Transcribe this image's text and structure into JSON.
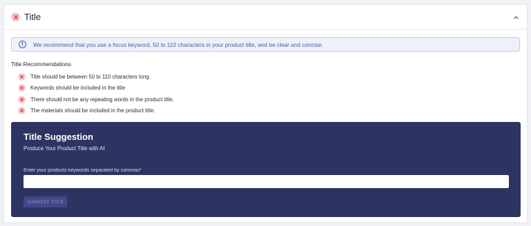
{
  "section": {
    "title": "Title",
    "status": "error",
    "expanded": true
  },
  "info": {
    "icon": "info-circle-icon",
    "text": "We recommend that you use a focus keyword, 50 to 110 characters in your product title, and be clear and concise."
  },
  "recommendations": {
    "heading": "Title Recommendations",
    "items": [
      {
        "label": "Title should be between 50 to 110 characters long",
        "status": "error"
      },
      {
        "label": "Keywords should be included in the title",
        "status": "error"
      },
      {
        "label": "There should not be any repeating words in the product title.",
        "status": "error"
      },
      {
        "label": "The materials should be included in the product title.",
        "status": "error"
      }
    ]
  },
  "suggestion": {
    "title": "Title Suggestion",
    "subtitle": "Produce Your Product Title with AI",
    "input_label": "Enter your products keywords separated by commas*",
    "input_value": "",
    "button_label": "SUGGEST TITLE",
    "button_disabled": true
  },
  "colors": {
    "error": "#e0434f",
    "error_bg": "#f6cdd0",
    "info_text": "#4a5aa8",
    "suggest_bg": "#2e3462"
  }
}
